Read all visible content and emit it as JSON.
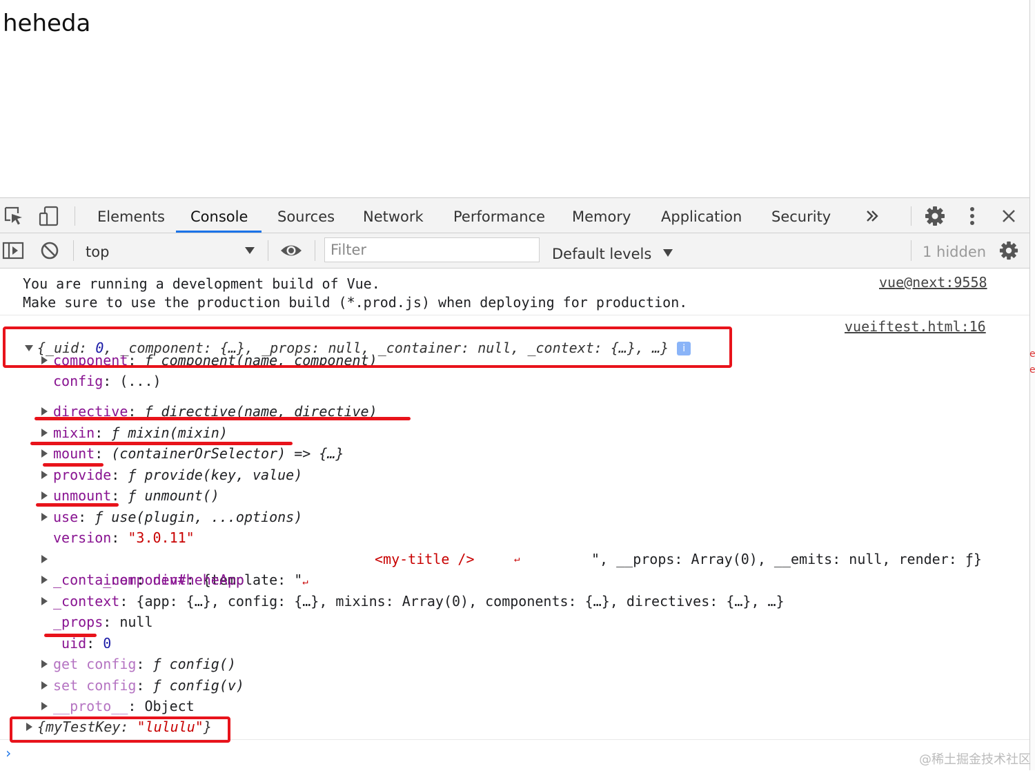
{
  "page": {
    "heading": "heheda"
  },
  "devtools": {
    "tabs": [
      {
        "label": "Elements",
        "active": false
      },
      {
        "label": "Console",
        "active": true
      },
      {
        "label": "Sources",
        "active": false
      },
      {
        "label": "Network",
        "active": false
      },
      {
        "label": "Performance",
        "active": false
      },
      {
        "label": "Memory",
        "active": false
      },
      {
        "label": "Application",
        "active": false
      },
      {
        "label": "Security",
        "active": false
      }
    ],
    "more_tabs_icon": "double-chevron-right",
    "toolbar_icons": [
      "inspect-element-icon",
      "device-toolbar-icon",
      "gear-icon",
      "kebab-menu-icon",
      "close-icon"
    ],
    "accent_color": "#1a73e8"
  },
  "console_toolbar": {
    "context": "top",
    "filter_placeholder": "Filter",
    "levels": "Default levels",
    "hidden": "1 hidden",
    "icons": [
      "sidebar-toggle-icon",
      "clear-console-icon",
      "dropdown-arrow-icon",
      "eye-icon",
      "settings-icon"
    ]
  },
  "console": {
    "warning": {
      "line1": "You are running a development build of Vue.",
      "line2": "Make sure to use the production build (*.prod.js) when deploying for production.",
      "source": "vue@next:9558"
    },
    "log_source": "vueiftest.html:16",
    "summary": {
      "uid_key": "_uid",
      "uid_val": "0",
      "rest": ", _component: {…}, _props: null, _container: null, _context: {…}, …}",
      "info_icon": "i"
    },
    "props": {
      "component": {
        "key": "component",
        "val": "ƒ component(name, component)"
      },
      "config": {
        "key": "config",
        "val": "(...)"
      },
      "directive": {
        "key": "directive",
        "val": "ƒ directive(name, directive)"
      },
      "mixin": {
        "key": "mixin",
        "val": "ƒ mixin(mixin)"
      },
      "mount": {
        "key": "mount",
        "val": "(containerOrSelector) => {…}"
      },
      "provide": {
        "key": "provide",
        "val": "ƒ provide(key, value)"
      },
      "unmount": {
        "key": "unmount",
        "val": "ƒ unmount()"
      },
      "use": {
        "key": "use",
        "val": "ƒ use(plugin, ...options)"
      },
      "version": {
        "key": "version",
        "val": "\"3.0.11\""
      },
      "component_internal": {
        "key": "_component",
        "pre": "{template: \"",
        "ret1": "↵",
        "tag": "<my-title />",
        "ret2": "↵",
        "post": "\", __props: Array(0), __emits: null, render: ƒ}"
      },
      "container": {
        "key": "_container",
        "val": "div#heheApp"
      },
      "context": {
        "key": "_context",
        "val": "{app: {…}, config: {…}, mixins: Array(0), components: {…}, directives: {…}, …}"
      },
      "props_internal": {
        "key": "_props",
        "val": "null"
      },
      "uid": {
        "key": "_uid",
        "val": "0"
      },
      "get_config": {
        "key": "get config",
        "val": "ƒ config()"
      },
      "set_config": {
        "key": "set config",
        "val": "ƒ config(v)"
      },
      "proto": {
        "key": "__proto__",
        "val": "Object"
      }
    },
    "second_log": {
      "pre": "{myTestKey: ",
      "val": "\"lululu\"",
      "post": "}"
    },
    "prompt": "›"
  },
  "annotation_color": "#e8131b",
  "watermark": "@稀土掘金技术社区"
}
